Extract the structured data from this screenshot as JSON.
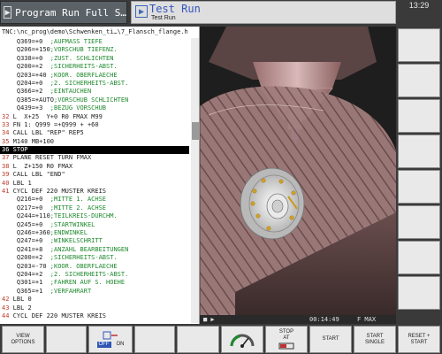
{
  "header": {
    "tab_active_label": "Program Run Full S…",
    "mode_title": "Test Run",
    "mode_subtitle": "Test Run",
    "clock": "13:29"
  },
  "program": {
    "path": "TNC:\\nc_prog\\demo\\Schwenken_ti…\\7_Flansch_flange.h",
    "lines": [
      {
        "indent": "    ",
        "n": "",
        "code": "Q369=+0",
        "comment": "  ;AUFMASS TIEFE"
      },
      {
        "indent": "    ",
        "n": "",
        "code": "Q206=+150",
        "comment": ";VORSCHUB TIEFENZ."
      },
      {
        "indent": "    ",
        "n": "",
        "code": "Q338=+0",
        "comment": "  ;ZUST. SCHLICHTEN"
      },
      {
        "indent": "    ",
        "n": "",
        "code": "Q200=+2",
        "comment": "  ;SICHERHEITS-ABST."
      },
      {
        "indent": "    ",
        "n": "",
        "code": "Q203=+40",
        "comment": " ;KOOR. OBERFLAECHE"
      },
      {
        "indent": "    ",
        "n": "",
        "code": "Q204=+0",
        "comment": "  ;2. SICHERHEITS-ABST."
      },
      {
        "indent": "    ",
        "n": "",
        "code": "Q366=+2",
        "comment": "  ;EINTAUCHEN"
      },
      {
        "indent": "    ",
        "n": "",
        "code": "Q385=+AUTO",
        "comment": ";VORSCHUB SCHLICHTEN"
      },
      {
        "indent": "    ",
        "n": "",
        "code": "Q439=+3",
        "comment": "  ;BEZUG VORSCHUB"
      },
      {
        "indent": "",
        "n": "32",
        "code": " L  X+25  Y+0 R0 FMAX M99",
        "comment": ""
      },
      {
        "indent": "",
        "n": "33",
        "code": " FN 1: Q999 =+Q999 + +60",
        "comment": ""
      },
      {
        "indent": "",
        "n": "34",
        "code": " CALL LBL \"REP\" REP5",
        "comment": ""
      },
      {
        "indent": "",
        "n": "35",
        "code": " M140 MB+100",
        "comment": ""
      },
      {
        "indent": "",
        "n": "36",
        "code": " STOP",
        "comment": ""
      },
      {
        "indent": "",
        "n": "37",
        "code": " PLANE RESET TURN FMAX",
        "comment": ""
      },
      {
        "indent": "",
        "n": "38",
        "code": " L  Z+150 R0 FMAX",
        "comment": ""
      },
      {
        "indent": "",
        "n": "39",
        "code": " CALL LBL \"END\"",
        "comment": ""
      },
      {
        "indent": "",
        "n": "40",
        "code": " LBL 1",
        "comment": ""
      },
      {
        "indent": "",
        "n": "41",
        "code": " CYCL DEF 220 MUSTER KREIS",
        "comment": ""
      },
      {
        "indent": "    ",
        "n": "",
        "code": "Q216=+0",
        "comment": "  ;MITTE 1. ACHSE"
      },
      {
        "indent": "    ",
        "n": "",
        "code": "Q217=+0",
        "comment": "  ;MITTE 2. ACHSE"
      },
      {
        "indent": "    ",
        "n": "",
        "code": "Q244=+110",
        "comment": ";TEILKREIS-DURCHM."
      },
      {
        "indent": "    ",
        "n": "",
        "code": "Q245=+0",
        "comment": "  ;STARTWINKEL"
      },
      {
        "indent": "    ",
        "n": "",
        "code": "Q246=+360",
        "comment": ";ENDWINKEL"
      },
      {
        "indent": "    ",
        "n": "",
        "code": "Q247=+0",
        "comment": "  ;WINKELSCHRITT"
      },
      {
        "indent": "    ",
        "n": "",
        "code": "Q241=+8",
        "comment": "  ;ANZAHL BEARBEITUNGEN"
      },
      {
        "indent": "    ",
        "n": "",
        "code": "Q200=+2",
        "comment": "  ;SICHERHEITS-ABST."
      },
      {
        "indent": "    ",
        "n": "",
        "code": "Q203=-70",
        "comment": " ;KOOR. OBERFLAECHE"
      },
      {
        "indent": "    ",
        "n": "",
        "code": "Q204=+2",
        "comment": "  ;2. SICHERHEITS-ABST."
      },
      {
        "indent": "    ",
        "n": "",
        "code": "Q301=+1",
        "comment": "  ;FAHREN AUF S. HOEHE"
      },
      {
        "indent": "    ",
        "n": "",
        "code": "Q365=+1",
        "comment": "  ;VERFAHRART"
      },
      {
        "indent": "",
        "n": "42",
        "code": " LBL 0",
        "comment": ""
      },
      {
        "indent": "",
        "n": "43",
        "code": " LBL 2",
        "comment": ""
      },
      {
        "indent": "",
        "n": "44",
        "code": " CYCL DEF 220 MUSTER KREIS",
        "comment": ""
      }
    ],
    "selected_index": 13
  },
  "status": {
    "time": "00:14:49",
    "feed": "F MAX"
  },
  "softkeys": {
    "view_options": "VIEW OPTIONS",
    "off": "OFF",
    "on": "ON",
    "stop_at": "STOP AT",
    "start": "START",
    "start_single": "START SINGLE",
    "reset_start": "RESET + START"
  },
  "colors": {
    "line_number": "#c0392b",
    "comment": "#1f8a2e",
    "selected_bg": "#000000",
    "accent": "#3355bb"
  }
}
